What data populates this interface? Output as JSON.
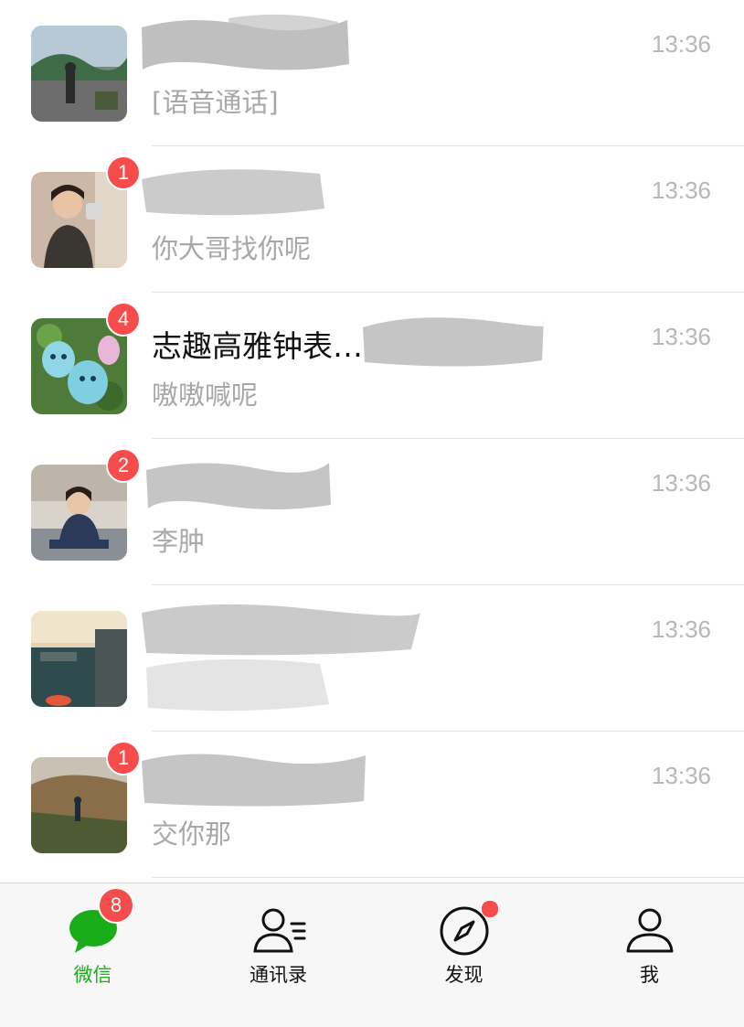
{
  "chats": [
    {
      "name": "",
      "message": "[语音通话]",
      "time": "13:36",
      "badge": "",
      "avatar": "street-photo"
    },
    {
      "name": "",
      "message": "你大哥找你呢",
      "time": "13:36",
      "badge": "1",
      "avatar": "person-selfie"
    },
    {
      "name": "志趣高雅钟表…",
      "message": "嗷嗷喊呢",
      "time": "13:36",
      "badge": "4",
      "avatar": "plush-toys"
    },
    {
      "name": "",
      "message": "李肿",
      "time": "13:36",
      "badge": "2",
      "avatar": "child-on-sofa"
    },
    {
      "name": "",
      "message": "",
      "time": "13:36",
      "badge": "",
      "avatar": "harbor-sunset"
    },
    {
      "name": "",
      "message": "交你那",
      "time": "13:36",
      "badge": "1",
      "avatar": "forest-trail"
    }
  ],
  "tabs": [
    {
      "label": "微信",
      "icon": "chat-bubble-icon",
      "badge": "8",
      "active": true
    },
    {
      "label": "通讯录",
      "icon": "contacts-icon",
      "badge": "",
      "active": false
    },
    {
      "label": "发现",
      "icon": "compass-icon",
      "badge": "dot",
      "active": false
    },
    {
      "label": "我",
      "icon": "profile-icon",
      "badge": "",
      "active": false
    }
  ],
  "colors": {
    "accent": "#1aad19",
    "badge": "#f74c4c",
    "time": "#b7b7b7",
    "preview": "#a8a8a8"
  }
}
